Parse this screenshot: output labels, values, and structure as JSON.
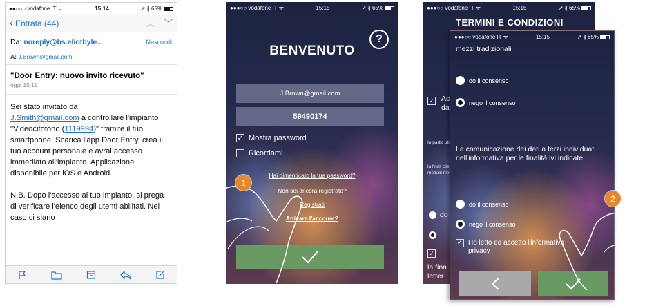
{
  "mail": {
    "status": {
      "carrier": "●●○○○ vodafone IT ᯤ",
      "time": "15:14",
      "right": "➚ ∦ 65%"
    },
    "nav": {
      "back_label": "Entrata (44)"
    },
    "from_label": "Da:",
    "from_addr": "noreply@bs.eliotbyle...",
    "hide_label": "Nascondi",
    "to_label": "A:",
    "to_addr": "J.Brown@gmail.com",
    "subject": "\"Door Entry: nuovo invito ricevuto\"",
    "date": "oggi 15:11",
    "body": {
      "p1_a": "Sei stato invitato da",
      "p1_link": "J.Smith@gmail.com",
      "p1_b": " a controllare l'impianto \"Videocitofono (",
      "p1_num": "1119994",
      "p1_c": ")\" tramite il tuo smartphone. Scarica l'app Door Entry, crea il tuo account personale e avrai accesso immediato all'impianto. Applicazione disponibile per iOS e Android.",
      "p2": "N.B. Dopo l'accesso al tuo impianto, si prega di verificare l'elenco degli utenti abilitati. Nel caso ci siano"
    },
    "toolbar": [
      "flag-icon",
      "folder-icon",
      "archive-icon",
      "reply-icon",
      "compose-icon"
    ]
  },
  "login": {
    "status": {
      "carrier": "●●●○○ vodafone IT ᯤ",
      "time": "15:15",
      "right": "➚ ∦ 65%"
    },
    "help": "?",
    "welcome": "BENVENUTO",
    "email": "J.Brown@gmail.com",
    "password": "59490174",
    "show_password": "Mostra password",
    "remember": "Ricordami",
    "forgot": "Hai dimenticato la tua password?",
    "not_registered": "Non sei ancora registrato?",
    "register": "Registrati",
    "activate": "Attivare l'account?",
    "confirm_icon": "check-icon"
  },
  "terms_back": {
    "status": {
      "carrier": "●●●○○ vodafone IT ᯤ",
      "time": "15:15",
      "right": "➚ ∦ 65%"
    },
    "title": "TERMINI E CONDIZIONI",
    "frag_ac": "Ac",
    "frag_da": "da",
    "small_a": "In partic utilizzar",
    "small_b": "la finali clientela modalit rilevano",
    "frag_la": "la fina letter",
    "frag_do": "do"
  },
  "terms_front": {
    "status": {
      "carrier": "●●●○○ vodafone IT ᯤ",
      "time": "15:15",
      "right": "➚ ∦ 65%"
    },
    "top_text": "mezzi tradizionali",
    "give_consent": "do il consenso",
    "deny_consent": "nego il consenso",
    "paragraph": "La comunicazione dei dati a terzi individuati nell'informativa per le finalità ivi indicate",
    "accept": "Ho letto ed accetto l'informativa privacy"
  },
  "steps": {
    "one": "1",
    "two": "2"
  },
  "colors": {
    "accent": "#e8862a",
    "confirm": "#6a9a63",
    "link": "#1a73d9",
    "back_button": "#a9a9a9"
  }
}
